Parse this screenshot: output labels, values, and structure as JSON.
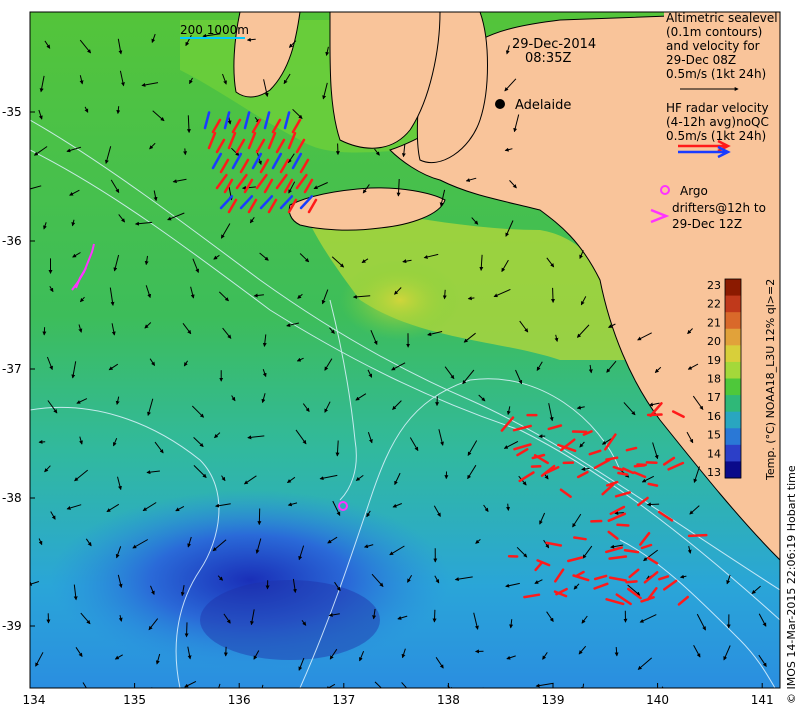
{
  "map": {
    "date": "29-Dec-2014",
    "time": "08:35Z",
    "city": "Adelaide",
    "scale_bar": "200  1000m",
    "lon_ticks": [
      "134",
      "135",
      "136",
      "137",
      "138",
      "139",
      "140",
      "141"
    ],
    "lat_ticks": [
      "-35",
      "-36",
      "-37",
      "-38",
      "-39"
    ]
  },
  "legend": {
    "alt_lines": [
      "Altimetric sealevel",
      "(0.1m contours)",
      "and velocity for",
      "29-Dec 08Z",
      "0.5m/s (1kt 24h)"
    ],
    "hf_lines": [
      "HF radar velocity",
      "(4-12h avg)noQC",
      "0.5m/s (1kt 24h)"
    ],
    "argo_line1": "Argo",
    "argo_lines": [
      "drifters@12h to",
      "29-Dec 12Z"
    ]
  },
  "colorbar": {
    "title": "Temp. (°C) NOAA18_L3U 12% ql>=2",
    "ticks": [
      "23",
      "22",
      "21",
      "20",
      "19",
      "18",
      "17",
      "16",
      "15",
      "14",
      "13"
    ],
    "colors": [
      "#8b1a00",
      "#c0391b",
      "#d9692a",
      "#e1a23a",
      "#d8cf3a",
      "#a4d83a",
      "#4ec83a",
      "#2fb878",
      "#29a6c0",
      "#2a78d6",
      "#2c3fc8",
      "#0a0a8a"
    ]
  },
  "credit": "© IMOS 14-Mar-2015 22:06:19 Hobart time",
  "colors": {
    "land": "#f9c49a",
    "hf_red": "#ff1a1a",
    "hf_blue": "#1a3cff",
    "argo": "#ff33ff"
  }
}
